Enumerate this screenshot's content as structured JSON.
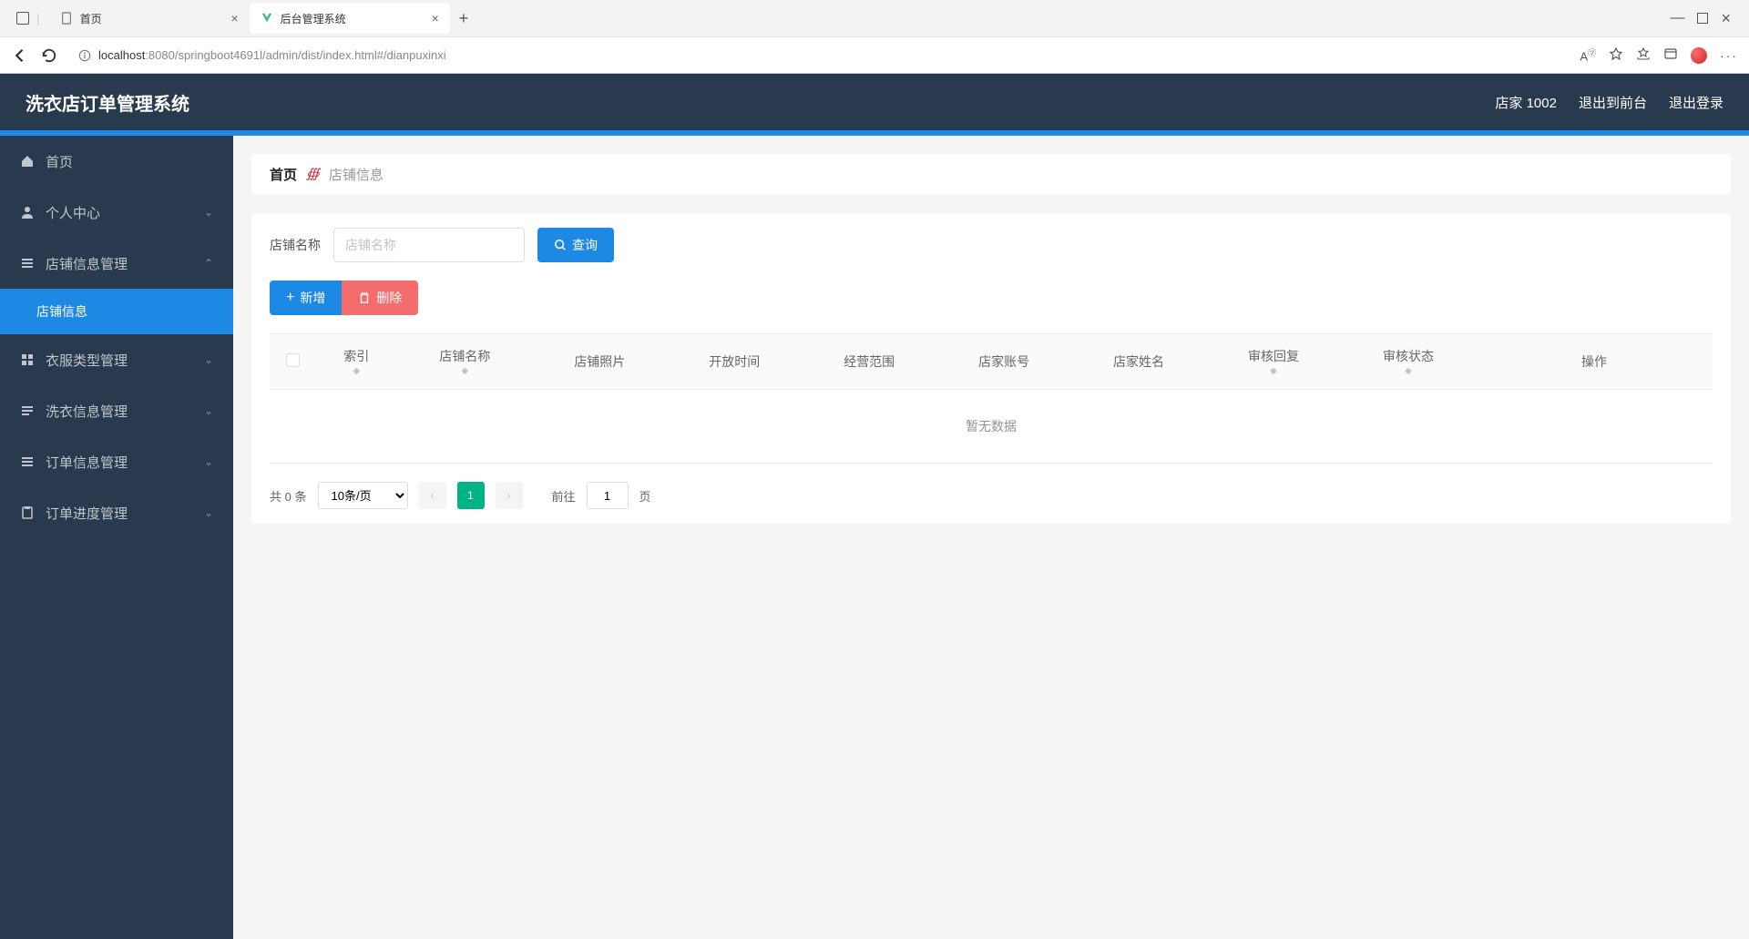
{
  "browser": {
    "tabs": [
      {
        "title": "首页",
        "active": false
      },
      {
        "title": "后台管理系统",
        "active": true
      }
    ],
    "url_host": "localhost",
    "url_port": ":8080",
    "url_path": "/springboot4691l/admin/dist/index.html#/dianpuxinxi"
  },
  "header": {
    "app_title": "洗衣店订单管理系统",
    "user_label": "店家 1002",
    "exit_front": "退出到前台",
    "logout": "退出登录"
  },
  "sidebar": {
    "items": [
      {
        "label": "首页",
        "icon": "home",
        "expandable": false
      },
      {
        "label": "个人中心",
        "icon": "user",
        "expandable": true
      },
      {
        "label": "店铺信息管理",
        "icon": "list",
        "expandable": true,
        "expanded": true,
        "children": [
          {
            "label": "店铺信息",
            "active": true
          }
        ]
      },
      {
        "label": "衣服类型管理",
        "icon": "grid",
        "expandable": true
      },
      {
        "label": "洗衣信息管理",
        "icon": "menu",
        "expandable": true
      },
      {
        "label": "订单信息管理",
        "icon": "list",
        "expandable": true
      },
      {
        "label": "订单进度管理",
        "icon": "clipboard",
        "expandable": true
      }
    ]
  },
  "breadcrumb": {
    "home": "首页",
    "current": "店铺信息"
  },
  "search": {
    "label": "店铺名称",
    "placeholder": "店铺名称",
    "query_btn": "查询"
  },
  "actions": {
    "add": "新增",
    "delete": "删除"
  },
  "table": {
    "columns": [
      "索引",
      "店铺名称",
      "店铺照片",
      "开放时间",
      "经营范围",
      "店家账号",
      "店家姓名",
      "审核回复",
      "审核状态",
      "操作"
    ],
    "sortable": [
      true,
      true,
      false,
      false,
      false,
      false,
      false,
      true,
      true,
      false
    ],
    "empty_text": "暂无数据"
  },
  "pagination": {
    "total_prefix": "共",
    "total_value": "0",
    "total_suffix": "条",
    "page_size": "10条/页",
    "current_page": "1",
    "goto_prefix": "前往",
    "goto_value": "1",
    "goto_suffix": "页"
  }
}
